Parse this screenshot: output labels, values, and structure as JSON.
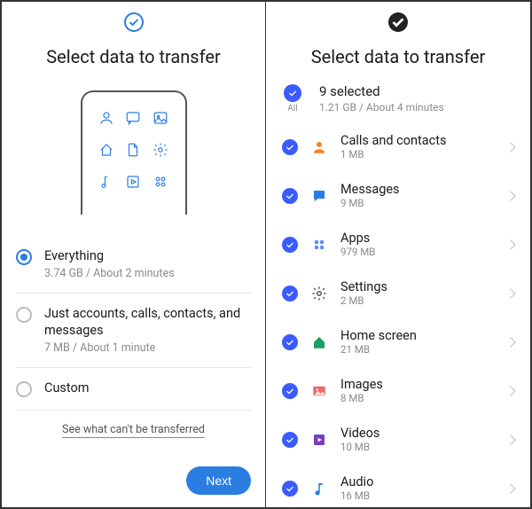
{
  "left": {
    "title": "Select data to transfer",
    "options": [
      {
        "title": "Everything",
        "subtitle": "3.74 GB / About 2 minutes",
        "selected": true
      },
      {
        "title": "Just accounts, calls, contacts, and messages",
        "subtitle": "7 MB / About 1 minute",
        "selected": false
      },
      {
        "title": "Custom",
        "subtitle": "",
        "selected": false
      }
    ],
    "link": "See what can't be transferred",
    "next_label": "Next"
  },
  "right": {
    "title": "Select data to transfer",
    "summary": {
      "all_label": "All",
      "selected_text": "9 selected",
      "subtitle": "1.21 GB / About 4 minutes"
    },
    "categories": [
      {
        "name": "Calls and contacts",
        "size": "1 MB",
        "icon": "contact",
        "color": "#f58220"
      },
      {
        "name": "Messages",
        "size": "9 MB",
        "icon": "message",
        "color": "#2a7de1"
      },
      {
        "name": "Apps",
        "size": "979 MB",
        "icon": "apps",
        "color": "#5a8cff"
      },
      {
        "name": "Settings",
        "size": "2 MB",
        "icon": "gear",
        "color": "#555"
      },
      {
        "name": "Home screen",
        "size": "21 MB",
        "icon": "home",
        "color": "#1aa060"
      },
      {
        "name": "Images",
        "size": "8 MB",
        "icon": "image",
        "color": "#e86d6d"
      },
      {
        "name": "Videos",
        "size": "10 MB",
        "icon": "video",
        "color": "#7a3fbf"
      },
      {
        "name": "Audio",
        "size": "16 MB",
        "icon": "audio",
        "color": "#2a7de1"
      }
    ]
  }
}
